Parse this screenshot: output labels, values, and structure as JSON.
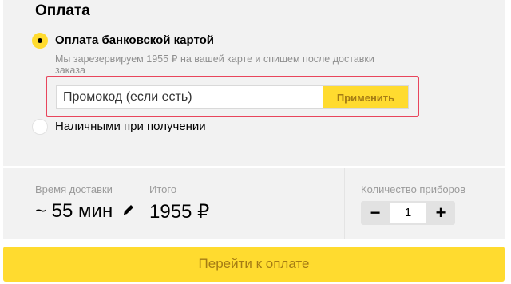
{
  "payment": {
    "title": "Оплата",
    "option_card": {
      "label": "Оплата банковской картой",
      "note": "Мы зарезервируем 1955 ₽ на вашей карте и спишем после доставки заказа",
      "selected": true
    },
    "promo": {
      "placeholder": "Промокод (если есть)",
      "apply_label": "Применить"
    },
    "option_cash": {
      "label": "Наличными при получении",
      "selected": false
    }
  },
  "summary": {
    "delivery_time_label": "Время доставки",
    "delivery_time_value": "~ 55 мин",
    "total_label": "Итого",
    "total_value": "1955 ₽",
    "cutlery_label": "Количество приборов",
    "cutlery_count": "1",
    "minus_label": "−",
    "plus_label": "+"
  },
  "checkout": {
    "button_label": "Перейти к оплате"
  },
  "colors": {
    "accent": "#ffdb2f",
    "accent_text": "#a57c14",
    "highlight": "#e8455c",
    "panel": "#f2f2f2"
  },
  "icons": {
    "edit": "pencil-icon"
  }
}
